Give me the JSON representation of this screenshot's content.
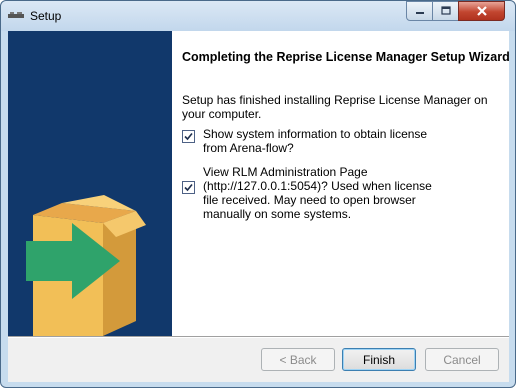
{
  "window": {
    "title": "Setup",
    "controls": [
      "minimize-icon",
      "maximize-icon",
      "close-icon"
    ]
  },
  "wizard": {
    "heading": "Completing the Reprise License Manager Setup Wizard",
    "description": "Setup has finished installing Reprise License Manager on your computer.",
    "options": [
      {
        "label": "Show system information to obtain license from Arena-flow?",
        "checked": true
      },
      {
        "label": "View RLM Administration Page (http://127.0.0.1:5054)?  Used when license file received.  May need to open browser manually on some systems.",
        "checked": true
      }
    ]
  },
  "buttons": {
    "back": "< Back",
    "finish": "Finish",
    "cancel": "Cancel"
  },
  "colors": {
    "banner": "#11386b",
    "box": "#f2bf57",
    "arrow": "#2fa36b"
  }
}
